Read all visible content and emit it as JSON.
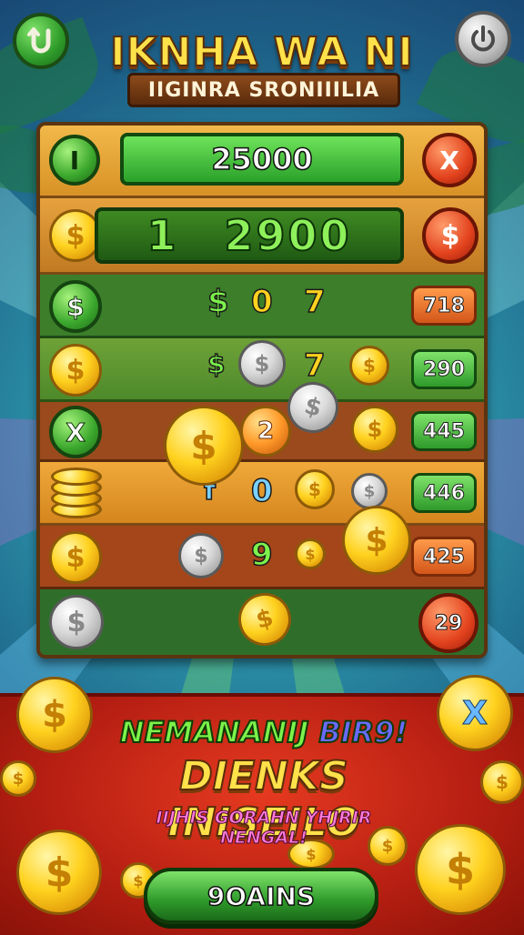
{
  "header": {
    "title": "IKNHA WA NI",
    "subtitle": "IIGINRA SRONIIILIA",
    "left_button_icon": "undo-icon",
    "right_button_icon": "power-icon"
  },
  "board": {
    "top_bar_value": "25000",
    "big_bar_left": "1",
    "big_bar_value": "2900",
    "rows": [
      {
        "left_icon": "I",
        "badge": ""
      },
      {
        "left_icon": "$",
        "badge": ""
      },
      {
        "left_icon": "$",
        "symbols": [
          "$",
          "0",
          "7"
        ],
        "badge": "718"
      },
      {
        "left_icon": "$",
        "symbols": [
          "$",
          "7"
        ],
        "badge": "290"
      },
      {
        "left_icon": "X",
        "symbols": [
          "2"
        ],
        "badge": "445"
      },
      {
        "left_icon": "coin-stack-icon",
        "symbols": [
          "f",
          "0"
        ],
        "badge": "446"
      },
      {
        "left_icon": "$",
        "symbols": [
          "9"
        ],
        "badge": "425"
      },
      {
        "left_icon": "silver-coin-icon",
        "badge": "29"
      }
    ],
    "close_symbol": "X"
  },
  "promo": {
    "line1a": "NEMANANIJ",
    "line1b": "BIR9!",
    "line2": "DIENKS INISEILO",
    "line3": "IIJHIS GORAHN YHJRIR NENGAL!",
    "button_label": "9OAINS"
  },
  "colors": {
    "title": "#ffe14a",
    "green": "#2aa12a",
    "red": "#e2421d",
    "coin": "#ffd21f"
  }
}
